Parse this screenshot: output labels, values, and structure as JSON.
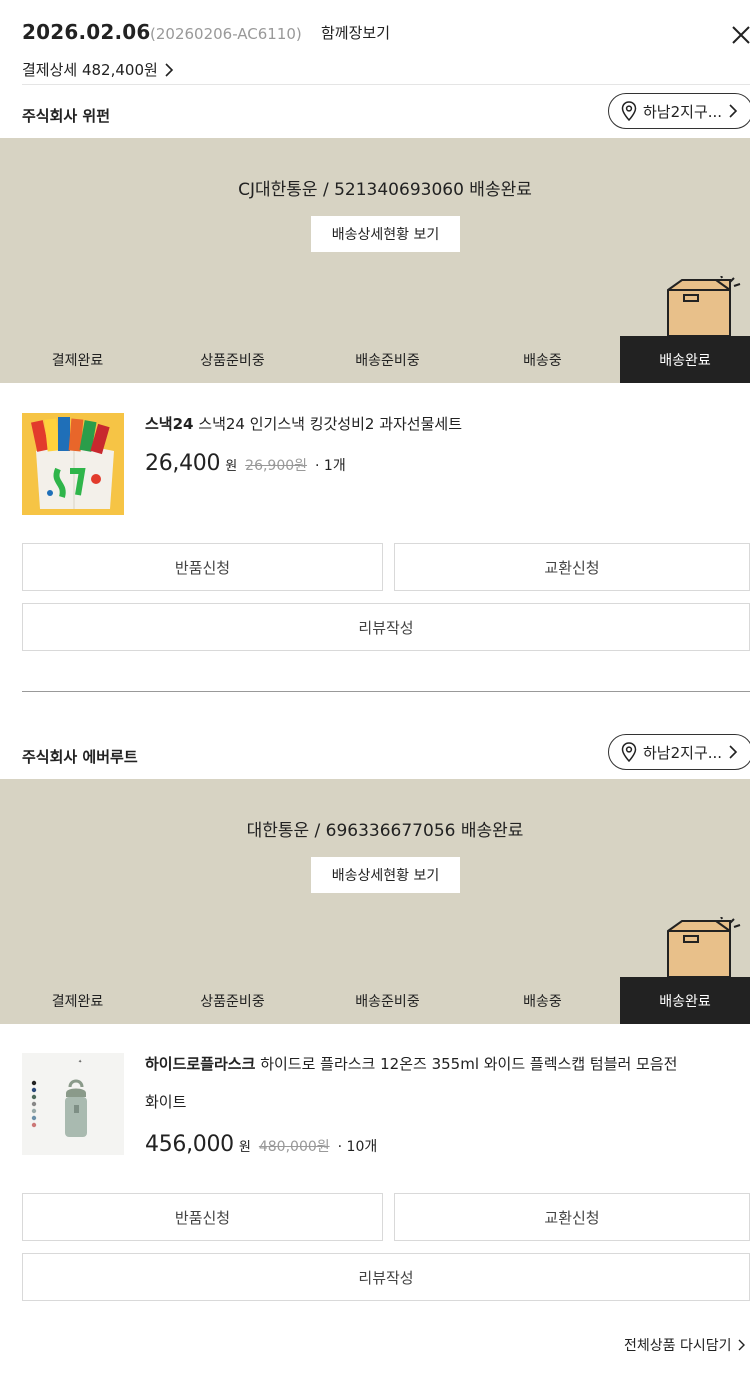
{
  "header": {
    "date": "2026.02.06",
    "order_no": "(20260206-AC6110)",
    "view_cart": "함께장보기",
    "pay_detail": "결제상세 482,400원"
  },
  "sections": [
    {
      "seller": "주식회사 위펀",
      "address": "하남2지구...",
      "delivery": "CJ대한통운 / 521340693060 배송완료",
      "detail_btn": "배송상세현황 보기",
      "steps": [
        "결제완료",
        "상품준비중",
        "배송준비중",
        "배송중",
        "배송완료"
      ],
      "active_step": 4,
      "product": {
        "brand": "스낵24",
        "name": "스낵24 인기스낵 킹갓성비2 과자선물세트",
        "name_line2": "",
        "price": "26,400",
        "won": "원",
        "original_price": "26,900원",
        "qty": "· 1개"
      },
      "buttons": {
        "return": "반품신청",
        "exchange": "교환신청",
        "review": "리뷰작성"
      }
    },
    {
      "seller": "주식회사 에버루트",
      "address": "하남2지구...",
      "delivery": "대한통운 / 696336677056 배송완료",
      "detail_btn": "배송상세현황 보기",
      "steps": [
        "결제완료",
        "상품준비중",
        "배송준비중",
        "배송중",
        "배송완료"
      ],
      "active_step": 4,
      "product": {
        "brand": "하이드로플라스크",
        "name": "하이드로 플라스크 12온즈 355ml 와이드 플렉스캡 텀블러 모음전",
        "name_line2": "화이트",
        "price": "456,000",
        "won": "원",
        "original_price": "480,000원",
        "qty": "· 10개"
      },
      "buttons": {
        "return": "반품신청",
        "exchange": "교환신청",
        "review": "리뷰작성"
      }
    }
  ],
  "footer": {
    "reorder": "전체상품 다시담기"
  },
  "colors": {
    "delivery_bg": "#d7d3c3",
    "active_step_bg": "#222222"
  }
}
